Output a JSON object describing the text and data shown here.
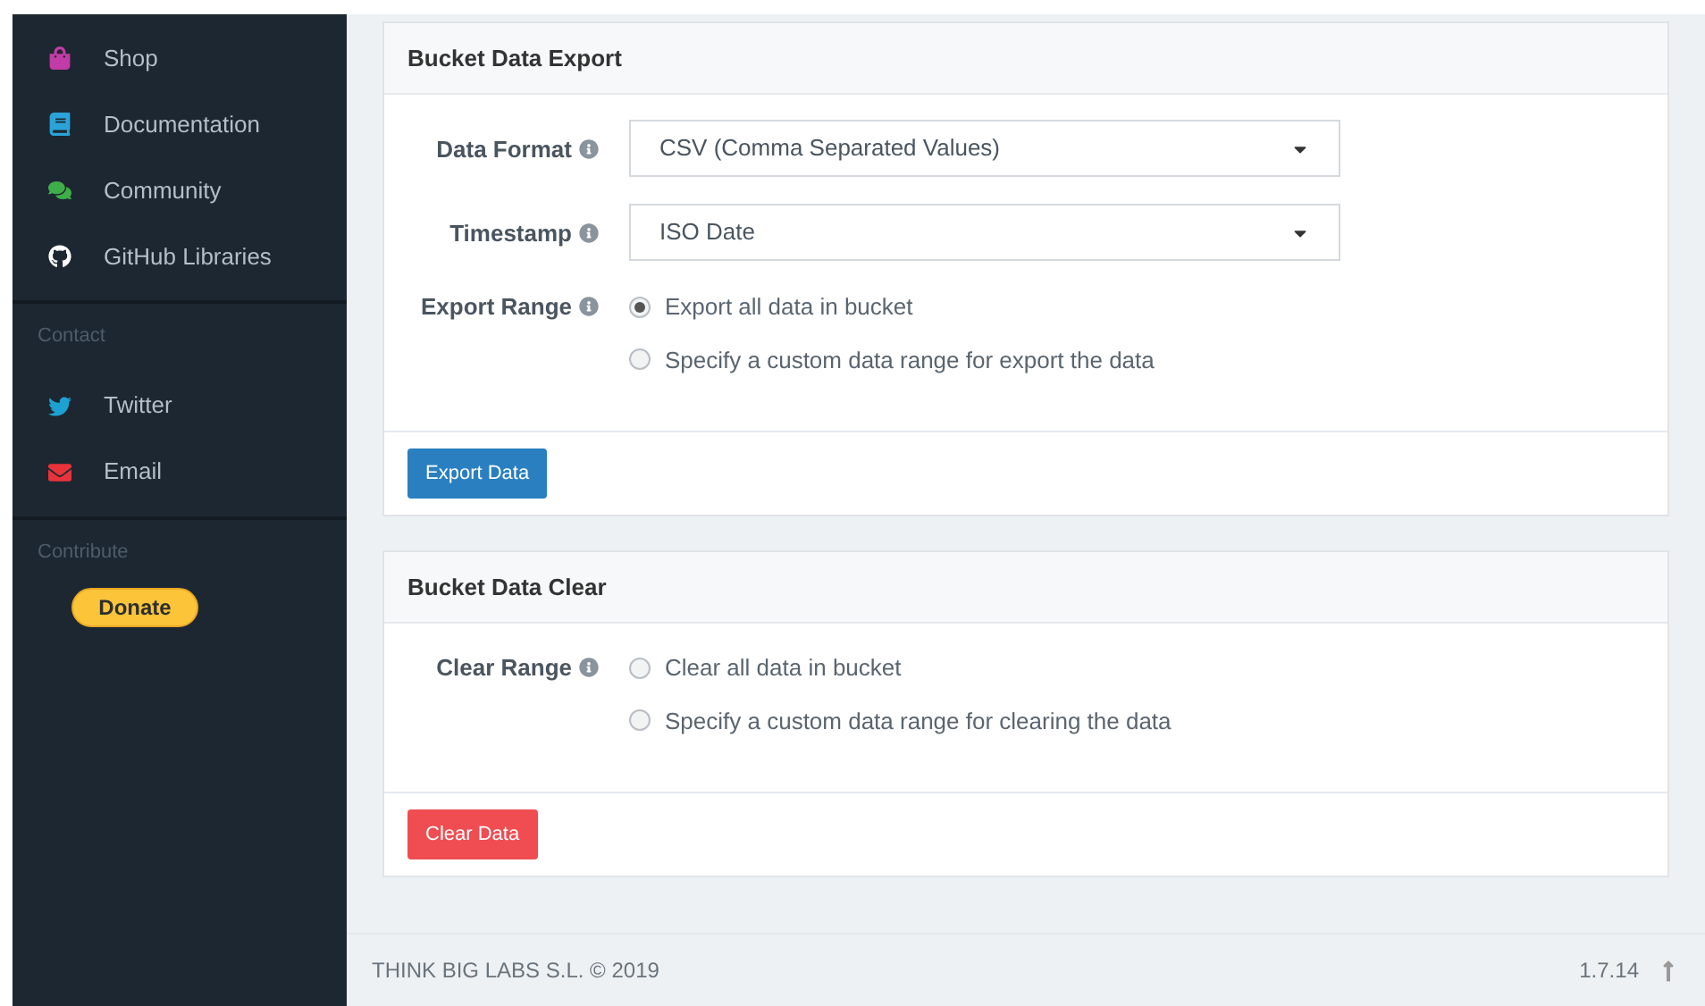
{
  "sidebar": {
    "sections": [
      {
        "items": [
          {
            "label": "Shop",
            "kind": "shop",
            "color": "#c13ca6"
          },
          {
            "label": "Documentation",
            "kind": "book",
            "color": "#2aa3d8"
          },
          {
            "label": "Community",
            "kind": "chat",
            "color": "#3fae49"
          },
          {
            "label": "GitHub Libraries",
            "kind": "github",
            "color": "#ffffff"
          }
        ]
      },
      {
        "heading": "Contact",
        "items": [
          {
            "label": "Twitter",
            "kind": "twitter",
            "color": "#1da1d2"
          },
          {
            "label": "Email",
            "kind": "email",
            "color": "#e8333a"
          }
        ]
      },
      {
        "heading": "Contribute",
        "donate": "Donate"
      }
    ]
  },
  "cards": [
    {
      "title": "Bucket Data Export",
      "fields": [
        {
          "kind": "select",
          "label": "Data Format",
          "value": "CSV (Comma Separated Values)"
        },
        {
          "kind": "select",
          "label": "Timestamp",
          "value": "ISO Date"
        },
        {
          "kind": "radio",
          "label": "Export Range",
          "options": [
            {
              "label": "Export all data in bucket",
              "selected": true
            },
            {
              "label": "Specify a custom data range for export the data",
              "selected": false
            }
          ]
        }
      ],
      "button": {
        "label": "Export Data",
        "kind": "primary"
      }
    },
    {
      "title": "Bucket Data Clear",
      "fields": [
        {
          "kind": "radio",
          "label": "Clear Range",
          "options": [
            {
              "label": "Clear all data in bucket",
              "selected": false
            },
            {
              "label": "Specify a custom data range for clearing the data",
              "selected": false
            }
          ]
        }
      ],
      "button": {
        "label": "Clear Data",
        "kind": "danger"
      }
    }
  ],
  "footer": {
    "copyright": "THINK BIG LABS S.L. © 2019",
    "version": "1.7.14"
  }
}
